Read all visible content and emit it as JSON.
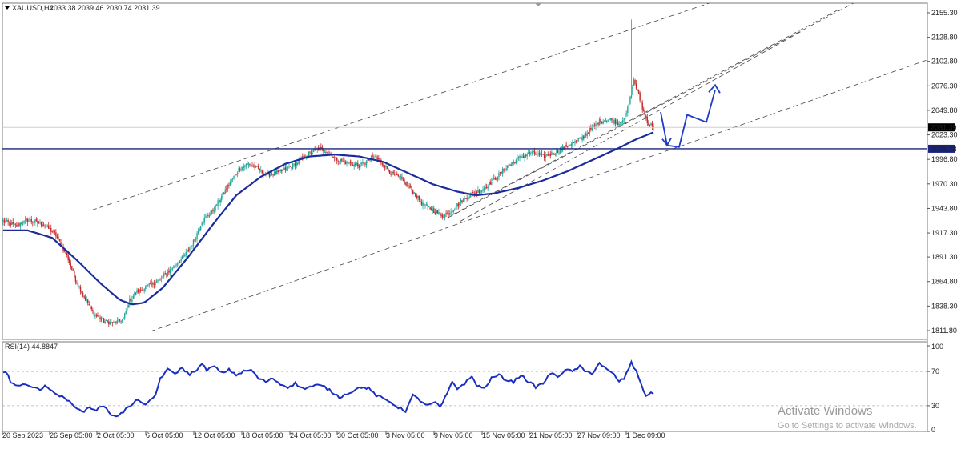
{
  "header": {
    "symbol": "XAUUSD,H4",
    "ohlc": "2033.38 2039.46 2030.74 2031.39"
  },
  "rsi_header": "RSI(14) 44.8847",
  "watermark": {
    "line1": "Activate Windows",
    "line2": "Go to Settings to activate Windows."
  },
  "colors": {
    "bull": "#26a69a",
    "bear": "#c62828",
    "ma": "#1a2b9c",
    "support": "#1a237e",
    "arrow": "#1e3cc8",
    "rsi": "#1a2fbf"
  },
  "chart_data": [
    {
      "type": "candlestick",
      "title": "",
      "xlabel": "",
      "ylabel": "",
      "x_ticks": [
        "20 Sep 2023",
        "26 Sep 05:00",
        "2 Oct 05:00",
        "6 Oct 05:00",
        "12 Oct 05:00",
        "18 Oct 05:00",
        "24 Oct 05:00",
        "30 Oct 05:00",
        "3 Nov 05:00",
        "9 Nov 05:00",
        "15 Nov 05:00",
        "21 Nov 05:00",
        "27 Nov 09:00",
        "1 Dec 09:00"
      ],
      "y_ticks": [
        "2155.30",
        "2128.80",
        "2102.80",
        "2076.30",
        "2049.80",
        "2023.30",
        "1996.80",
        "1970.30",
        "1943.80",
        "1917.30",
        "1891.30",
        "1864.80",
        "1838.30",
        "1811.80"
      ],
      "ylim": [
        1804,
        2160
      ],
      "current_price": "2031.39",
      "support_level": "2008.28",
      "anchors": [
        [
          0,
          1930
        ],
        [
          10,
          1925
        ],
        [
          20,
          1931
        ],
        [
          32,
          1927
        ],
        [
          42,
          1917
        ],
        [
          52,
          1893
        ],
        [
          58,
          1870
        ],
        [
          66,
          1848
        ],
        [
          74,
          1830
        ],
        [
          82,
          1822
        ],
        [
          90,
          1820
        ],
        [
          98,
          1824
        ],
        [
          102,
          1842
        ],
        [
          108,
          1853
        ],
        [
          118,
          1860
        ],
        [
          128,
          1867
        ],
        [
          138,
          1880
        ],
        [
          148,
          1893
        ],
        [
          156,
          1910
        ],
        [
          162,
          1930
        ],
        [
          170,
          1940
        ],
        [
          176,
          1952
        ],
        [
          184,
          1970
        ],
        [
          192,
          1986
        ],
        [
          200,
          1992
        ],
        [
          206,
          1988
        ],
        [
          214,
          1980
        ],
        [
          224,
          1982
        ],
        [
          236,
          1990
        ],
        [
          248,
          2002
        ],
        [
          256,
          2008
        ],
        [
          264,
          2006
        ],
        [
          270,
          1998
        ],
        [
          280,
          1993
        ],
        [
          290,
          1990
        ],
        [
          296,
          1994
        ],
        [
          302,
          2000
        ],
        [
          308,
          1994
        ],
        [
          316,
          1982
        ],
        [
          324,
          1976
        ],
        [
          334,
          1962
        ],
        [
          342,
          1948
        ],
        [
          350,
          1942
        ],
        [
          358,
          1936
        ],
        [
          364,
          1940
        ],
        [
          372,
          1950
        ],
        [
          380,
          1958
        ],
        [
          390,
          1964
        ],
        [
          400,
          1975
        ],
        [
          410,
          1988
        ],
        [
          420,
          1998
        ],
        [
          430,
          2004
        ],
        [
          440,
          2000
        ],
        [
          450,
          2004
        ],
        [
          460,
          2012
        ],
        [
          470,
          2018
        ],
        [
          478,
          2028
        ],
        [
          486,
          2038
        ],
        [
          494,
          2040
        ],
        [
          502,
          2036
        ],
        [
          508,
          2046
        ],
        [
          512,
          2068
        ],
        [
          514,
          2083
        ],
        [
          518,
          2066
        ],
        [
          522,
          2048
        ],
        [
          526,
          2035
        ],
        [
          530,
          2033
        ]
      ],
      "ma_anchors": [
        [
          0,
          1920
        ],
        [
          20,
          1920
        ],
        [
          40,
          1912
        ],
        [
          60,
          1888
        ],
        [
          80,
          1862
        ],
        [
          95,
          1845
        ],
        [
          105,
          1840
        ],
        [
          115,
          1842
        ],
        [
          130,
          1858
        ],
        [
          150,
          1890
        ],
        [
          170,
          1925
        ],
        [
          190,
          1958
        ],
        [
          210,
          1978
        ],
        [
          230,
          1992
        ],
        [
          250,
          2000
        ],
        [
          270,
          2002
        ],
        [
          290,
          2000
        ],
        [
          310,
          1994
        ],
        [
          330,
          1982
        ],
        [
          350,
          1970
        ],
        [
          370,
          1962
        ],
        [
          385,
          1958
        ],
        [
          400,
          1960
        ],
        [
          420,
          1966
        ],
        [
          440,
          1974
        ],
        [
          460,
          1984
        ],
        [
          480,
          1996
        ],
        [
          500,
          2008
        ],
        [
          515,
          2018
        ],
        [
          530,
          2026
        ]
      ],
      "spike": {
        "index": 512,
        "high": 2148
      },
      "trendlines": [
        {
          "style": "dashed",
          "from": [
            1811,
            "6 Oct"
          ],
          "to": [
            2105,
            "end"
          ]
        },
        {
          "style": "dashed",
          "from": [
            1942,
            "28 Sep"
          ],
          "to": [
            2167,
            "end"
          ]
        },
        {
          "style": "dashed",
          "from": [
            1934,
            "9 Nov"
          ],
          "to": [
            2170,
            "end"
          ]
        },
        {
          "style": "dashed",
          "from": [
            1930,
            "9 Nov"
          ],
          "to": [
            2135,
            "end"
          ]
        },
        {
          "style": "dashed",
          "from": [
            1937,
            "9 Nov"
          ],
          "to": [
            2142,
            "end"
          ]
        }
      ],
      "projection": [
        {
          "date": "1 Dec",
          "price": 2048
        },
        {
          "date": "1 Dec",
          "price": 2012
        },
        {
          "date": "2 Dec",
          "price": 2010
        },
        {
          "date": "3 Dec",
          "price": 2045
        },
        {
          "date": "4 Dec",
          "price": 2037
        },
        {
          "date": "5 Dec",
          "price": 2072
        }
      ]
    },
    {
      "type": "line",
      "title": "",
      "name": "RSI(14)",
      "ylim": [
        0,
        100
      ],
      "y_ticks": [
        "100",
        "70",
        "30",
        "0"
      ],
      "levels": [
        70,
        30
      ],
      "last_value": 44.8847,
      "anchors": [
        [
          0,
          68
        ],
        [
          3,
          72
        ],
        [
          6,
          58
        ],
        [
          12,
          52
        ],
        [
          18,
          56
        ],
        [
          24,
          52
        ],
        [
          30,
          48
        ],
        [
          34,
          55
        ],
        [
          40,
          46
        ],
        [
          46,
          42
        ],
        [
          50,
          38
        ],
        [
          56,
          33
        ],
        [
          60,
          28
        ],
        [
          64,
          22
        ],
        [
          70,
          28
        ],
        [
          76,
          25
        ],
        [
          80,
          30
        ],
        [
          84,
          26
        ],
        [
          88,
          20
        ],
        [
          94,
          18
        ],
        [
          100,
          26
        ],
        [
          106,
          32
        ],
        [
          110,
          38
        ],
        [
          116,
          30
        ],
        [
          120,
          36
        ],
        [
          124,
          42
        ],
        [
          128,
          62
        ],
        [
          134,
          72
        ],
        [
          140,
          68
        ],
        [
          146,
          74
        ],
        [
          152,
          66
        ],
        [
          158,
          73
        ],
        [
          162,
          78
        ],
        [
          166,
          72
        ],
        [
          172,
          76
        ],
        [
          178,
          68
        ],
        [
          184,
          72
        ],
        [
          190,
          66
        ],
        [
          196,
          70
        ],
        [
          202,
          72
        ],
        [
          208,
          62
        ],
        [
          214,
          58
        ],
        [
          220,
          62
        ],
        [
          226,
          55
        ],
        [
          232,
          52
        ],
        [
          238,
          56
        ],
        [
          244,
          50
        ],
        [
          250,
          52
        ],
        [
          256,
          54
        ],
        [
          262,
          52
        ],
        [
          268,
          46
        ],
        [
          274,
          40
        ],
        [
          280,
          44
        ],
        [
          286,
          48
        ],
        [
          292,
          52
        ],
        [
          298,
          50
        ],
        [
          304,
          42
        ],
        [
          310,
          38
        ],
        [
          316,
          34
        ],
        [
          322,
          28
        ],
        [
          328,
          24
        ],
        [
          334,
          42
        ],
        [
          340,
          36
        ],
        [
          346,
          30
        ],
        [
          352,
          34
        ],
        [
          356,
          28
        ],
        [
          362,
          44
        ],
        [
          366,
          58
        ],
        [
          370,
          50
        ],
        [
          376,
          56
        ],
        [
          382,
          64
        ],
        [
          386,
          54
        ],
        [
          392,
          50
        ],
        [
          398,
          62
        ],
        [
          404,
          66
        ],
        [
          410,
          60
        ],
        [
          416,
          58
        ],
        [
          422,
          66
        ],
        [
          428,
          58
        ],
        [
          434,
          52
        ],
        [
          440,
          56
        ],
        [
          446,
          68
        ],
        [
          452,
          64
        ],
        [
          458,
          72
        ],
        [
          464,
          70
        ],
        [
          470,
          76
        ],
        [
          474,
          70
        ],
        [
          480,
          68
        ],
        [
          486,
          80
        ],
        [
          492,
          72
        ],
        [
          498,
          66
        ],
        [
          502,
          58
        ],
        [
          506,
          62
        ],
        [
          512,
          80
        ],
        [
          516,
          70
        ],
        [
          520,
          56
        ],
        [
          524,
          40
        ],
        [
          528,
          46
        ],
        [
          530,
          45
        ]
      ]
    }
  ]
}
